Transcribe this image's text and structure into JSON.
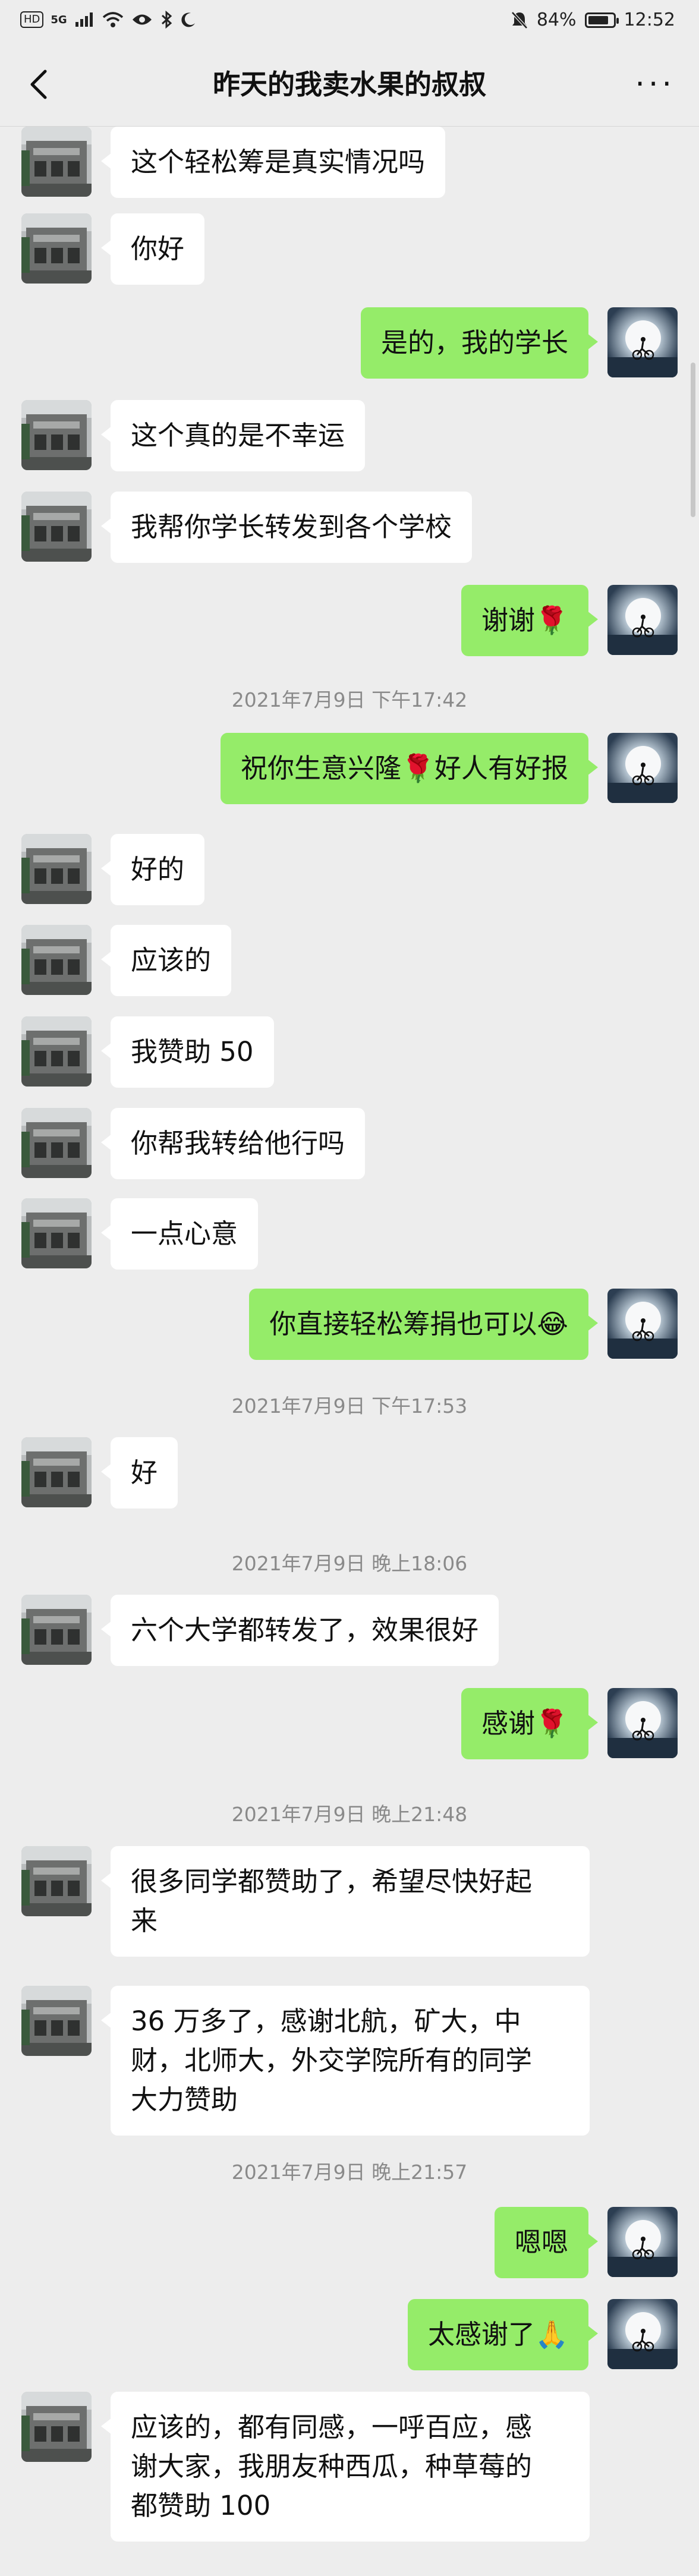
{
  "status_bar": {
    "left_chips": [
      "HD",
      "5G"
    ],
    "battery": "84%",
    "battery_level": 0.84,
    "time": "12:52"
  },
  "navbar": {
    "title": "昨天的我卖水果的叔叔",
    "more": "···"
  },
  "messages": [
    {
      "side": "left",
      "text": "这个轻松筹是真实情况吗"
    },
    {
      "side": "left",
      "text": "你好"
    },
    {
      "side": "right",
      "text": "是的，我的学长"
    },
    {
      "side": "left",
      "text": "这个真的是不幸运"
    },
    {
      "side": "left",
      "text": "我帮你学长转发到各个学校"
    },
    {
      "side": "right",
      "text": "谢谢",
      "emoji": "🌹"
    },
    {
      "timestamp": "2021年7月9日 下午17:42"
    },
    {
      "side": "right",
      "text": "祝你生意兴隆",
      "emoji": "🌹",
      "text2": "好人有好报"
    },
    {
      "side": "left",
      "text": "好的"
    },
    {
      "side": "left",
      "text": "应该的"
    },
    {
      "side": "left",
      "text": "我赞助 50"
    },
    {
      "side": "left",
      "text": "你帮我转给他行吗"
    },
    {
      "side": "left",
      "text": "一点心意"
    },
    {
      "side": "right",
      "text": "你直接轻松筹捐也可以",
      "emoji": "😂"
    },
    {
      "timestamp": "2021年7月9日 下午17:53"
    },
    {
      "side": "left",
      "text": "好"
    },
    {
      "timestamp": "2021年7月9日 晚上18:06"
    },
    {
      "side": "left",
      "text": "六个大学都转发了，效果很好"
    },
    {
      "side": "right",
      "text": "感谢",
      "emoji": "🌹"
    },
    {
      "timestamp": "2021年7月9日 晚上21:48"
    },
    {
      "side": "left",
      "lines": [
        "很多同学都赞助了，希望尽快好起",
        "来"
      ]
    },
    {
      "side": "left",
      "lines": [
        "36 万多了，感谢北航，矿大，中",
        "财，北师大，外交学院所有的同学",
        "大力赞助"
      ]
    },
    {
      "timestamp": "2021年7月9日 晚上21:57"
    },
    {
      "side": "right",
      "text": "嗯嗯"
    },
    {
      "side": "right",
      "text": "太感谢了",
      "emoji": "🙏"
    },
    {
      "side": "left",
      "lines": [
        "应该的，都有同感，一呼百应，感",
        "谢大家，我朋友种西瓜，种草莓的",
        "都赞助 100"
      ]
    }
  ]
}
